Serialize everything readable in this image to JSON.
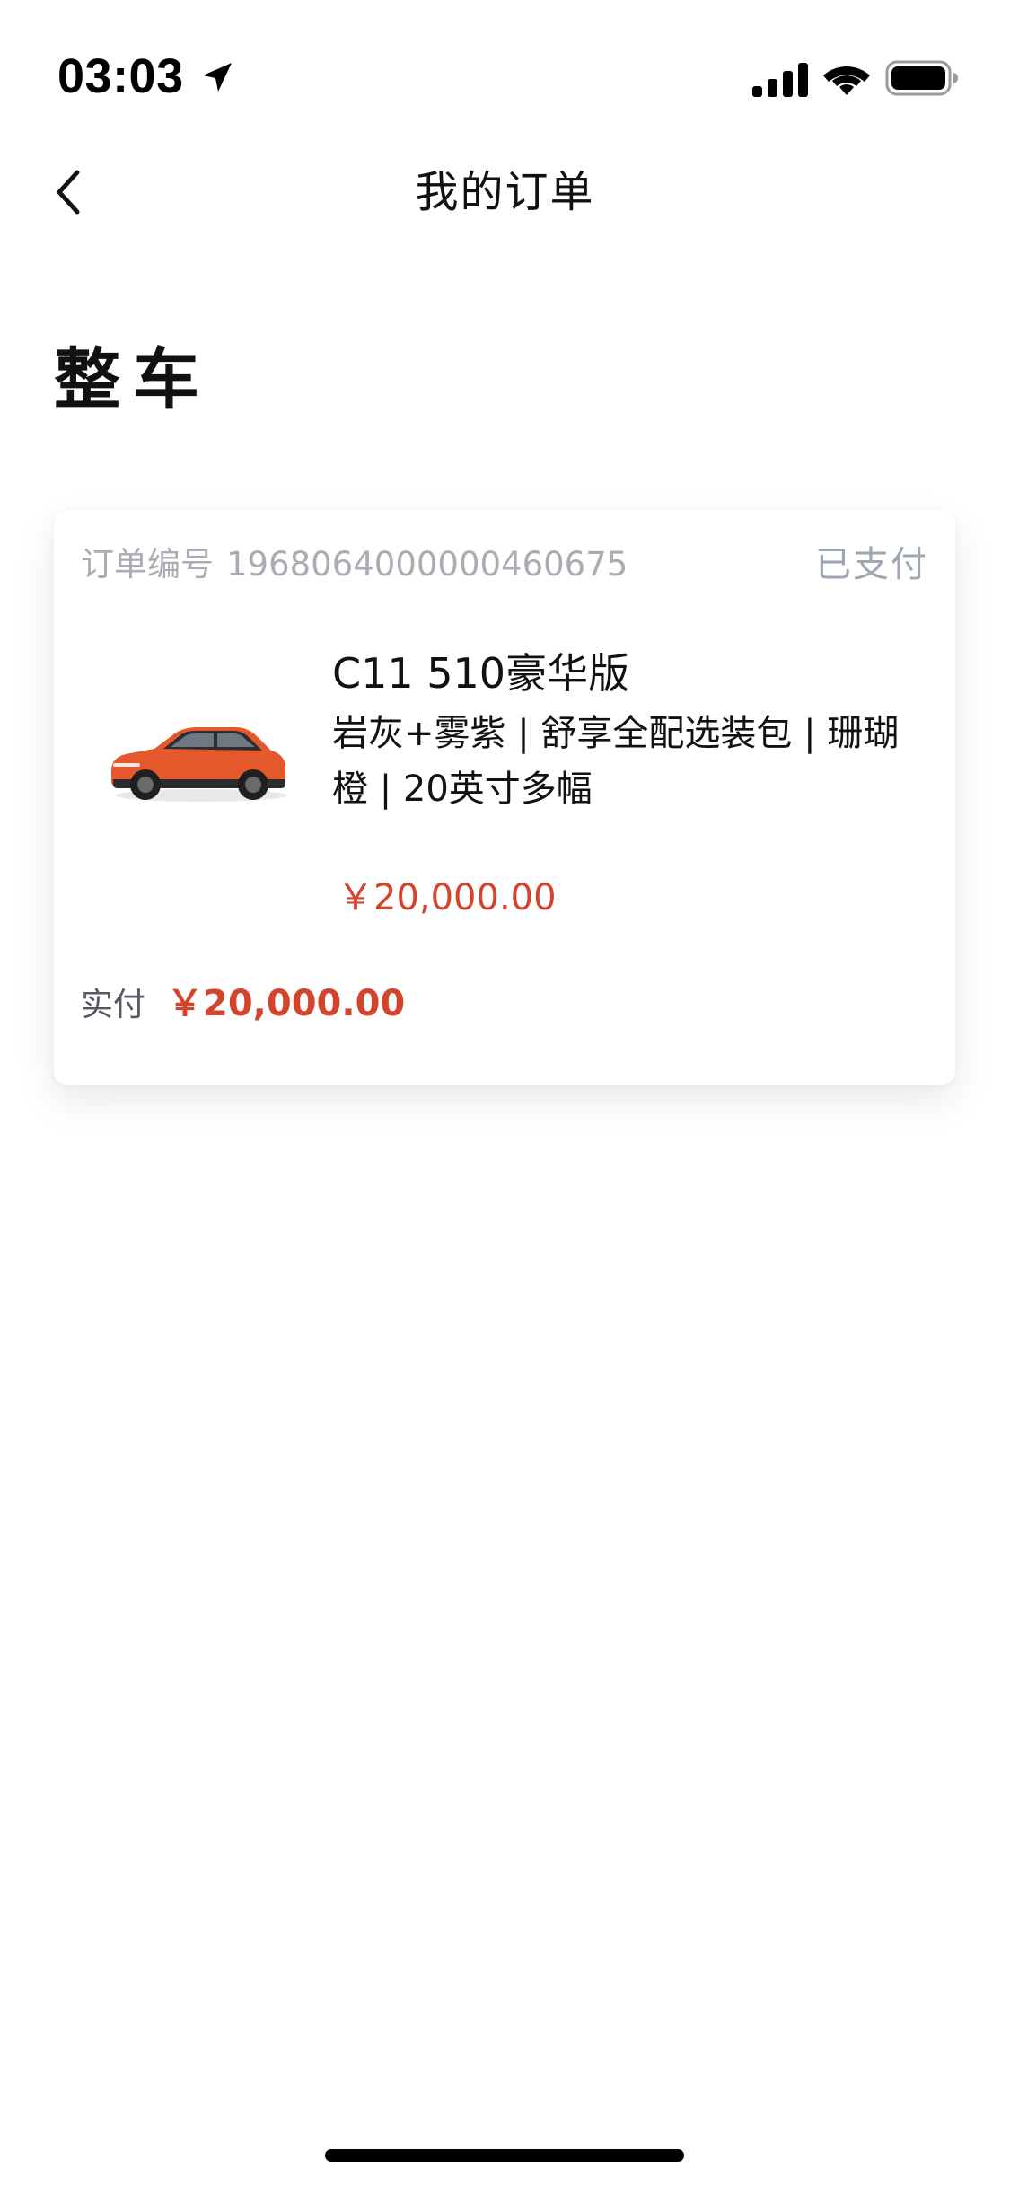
{
  "status_bar": {
    "time": "03:03"
  },
  "nav": {
    "title": "我的订单"
  },
  "section": {
    "title": "整车"
  },
  "order": {
    "number_label": "订单编号",
    "number": "1968064000000460675",
    "status": "已支付",
    "product_name": "C11 510豪华版",
    "options": "岩灰+雾紫 | 舒享全配选装包 | 珊瑚橙 | 20英寸多幅",
    "price": "￥20,000.00",
    "paid_label": "实付",
    "paid_amount": "￥20,000.00"
  },
  "colors": {
    "accent_price": "#d4432c",
    "status_text": "#9ea6b3",
    "car_body": "#e4582c"
  },
  "icons": [
    "location-arrow-icon",
    "cellular-signal-icon",
    "wifi-icon",
    "battery-icon",
    "chevron-left-icon"
  ]
}
